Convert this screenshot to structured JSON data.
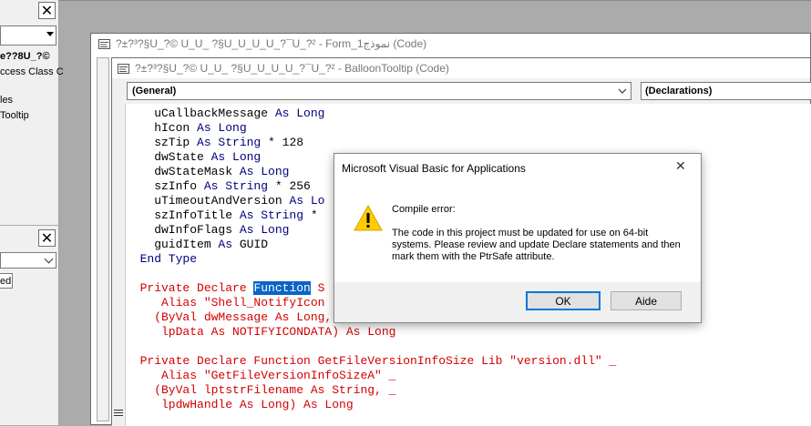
{
  "project_panel": {
    "title_fragment": "e??8U_?©",
    "items": [
      "ccess Class C",
      "les",
      "Tooltip"
    ]
  },
  "properties_panel": {
    "item": "ed"
  },
  "form_window": {
    "title": "?±?³?§U_?© U_U_ ?§U_U_U_U_?¯U_?² - Form_1نموذج (Code)"
  },
  "balloon_window": {
    "title": "?±?³?§U_?© U_U_ ?§U_U_U_U_?¯U_?² - BalloonTooltip (Code)",
    "object_combo": "(General)",
    "procedure_combo": "(Declarations)",
    "code_lines": [
      [
        {
          "t": "    uCallbackMessage ",
          "c": ""
        },
        {
          "t": "As Long",
          "c": "kw"
        }
      ],
      [
        {
          "t": "    hIcon ",
          "c": ""
        },
        {
          "t": "As Long",
          "c": "kw"
        }
      ],
      [
        {
          "t": "    szTip ",
          "c": ""
        },
        {
          "t": "As String",
          "c": "kw"
        },
        {
          "t": " * 128",
          "c": ""
        }
      ],
      [
        {
          "t": "    dwState ",
          "c": ""
        },
        {
          "t": "As Long",
          "c": "kw"
        }
      ],
      [
        {
          "t": "    dwStateMask ",
          "c": ""
        },
        {
          "t": "As Long",
          "c": "kw"
        }
      ],
      [
        {
          "t": "    szInfo ",
          "c": ""
        },
        {
          "t": "As String",
          "c": "kw"
        },
        {
          "t": " * 256",
          "c": ""
        }
      ],
      [
        {
          "t": "    uTimeoutAndVersion ",
          "c": ""
        },
        {
          "t": "As Lo",
          "c": "kw"
        }
      ],
      [
        {
          "t": "    szInfoTitle ",
          "c": ""
        },
        {
          "t": "As String",
          "c": "kw"
        },
        {
          "t": " *",
          "c": ""
        }
      ],
      [
        {
          "t": "    dwInfoFlags ",
          "c": ""
        },
        {
          "t": "As Long",
          "c": "kw"
        }
      ],
      [
        {
          "t": "    guidItem ",
          "c": ""
        },
        {
          "t": "As",
          "c": "kw"
        },
        {
          "t": " GUID",
          "c": ""
        }
      ],
      [
        {
          "t": "  End Type",
          "c": "kw"
        }
      ],
      [
        {
          "t": "",
          "c": ""
        }
      ],
      [
        {
          "t": "  Private Declare ",
          "c": "red"
        },
        {
          "t": "Function",
          "c": "hl"
        },
        {
          "t": " S",
          "c": "red"
        }
      ],
      [
        {
          "t": "     Alias \"Shell_NotifyIcon",
          "c": "red"
        }
      ],
      [
        {
          "t": "    (ByVal dwMessage As Long, _",
          "c": "red"
        }
      ],
      [
        {
          "t": "     lpData As NOTIFYICONDATA) As Long",
          "c": "red"
        }
      ],
      [
        {
          "t": "",
          "c": ""
        }
      ],
      [
        {
          "t": "  Private Declare Function GetFileVersionInfoSize Lib \"version.dll\" _",
          "c": "red"
        }
      ],
      [
        {
          "t": "     Alias \"GetFileVersionInfoSizeA\" _",
          "c": "red"
        }
      ],
      [
        {
          "t": "    (ByVal lptstrFilename As String, _",
          "c": "red"
        }
      ],
      [
        {
          "t": "     lpdwHandle As Long) As Long",
          "c": "red"
        }
      ]
    ]
  },
  "dialog": {
    "title": "Microsoft Visual Basic for Applications",
    "heading": "Compile error:",
    "message": "The code in this project must be updated for use on 64-bit systems.  Please review and update Declare statements and then mark them with the PtrSafe attribute.",
    "ok_label": "OK",
    "help_label": "Aide",
    "close_glyph": "✕",
    "icon": "warning-icon"
  },
  "colors": {
    "keyword": "#00007f",
    "error_line": "#d40000",
    "selection": "#0a64c8",
    "default_button_border": "#0078d7"
  }
}
